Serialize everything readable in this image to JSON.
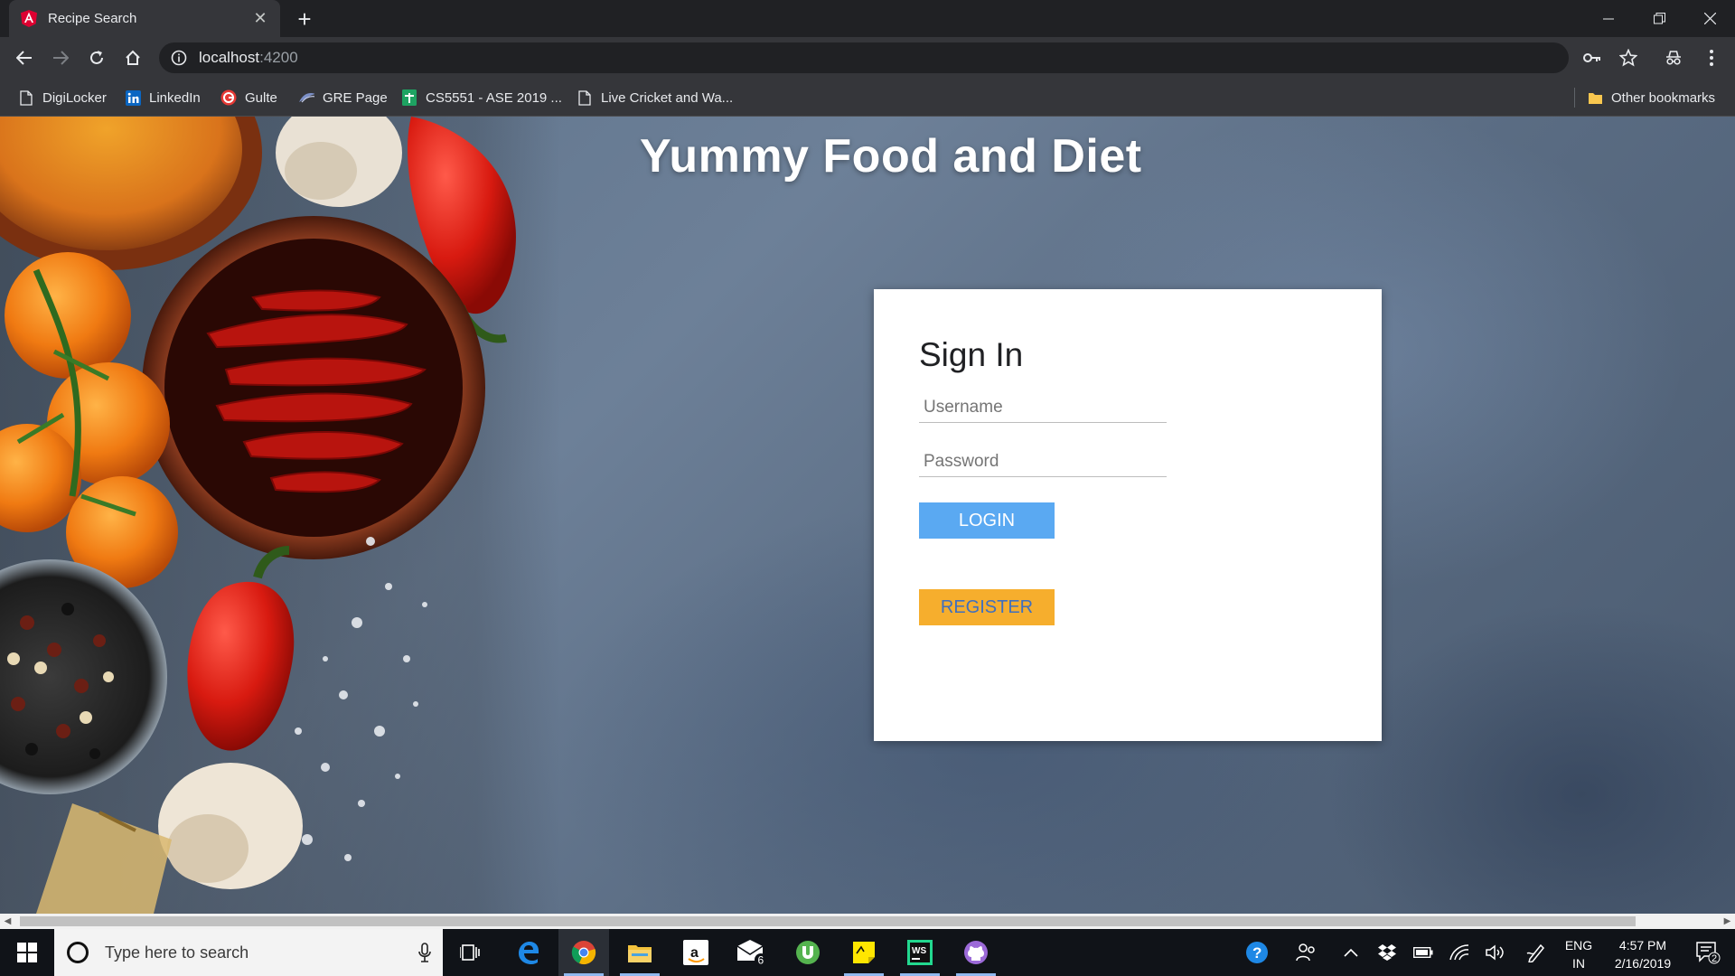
{
  "browser": {
    "tab_title": "Recipe Search",
    "url_host": "localhost",
    "url_port": ":4200",
    "bookmarks": [
      {
        "label": "DigiLocker",
        "icon": "page-icon"
      },
      {
        "label": "LinkedIn",
        "icon": "linkedin-icon"
      },
      {
        "label": "Gulte",
        "icon": "gulte-icon"
      },
      {
        "label": "GRE Page",
        "icon": "gre-icon"
      },
      {
        "label": "CS5551 - ASE 2019 ...",
        "icon": "sheets-icon"
      },
      {
        "label": "Live Cricket and Wa...",
        "icon": "page-icon"
      }
    ],
    "other_bookmarks": "Other bookmarks"
  },
  "page": {
    "title": "Yummy Food and Diet",
    "signin": {
      "heading": "Sign In",
      "username_placeholder": "Username",
      "password_placeholder": "Password",
      "login_label": "LOGIN",
      "register_label": "REGISTER"
    }
  },
  "taskbar": {
    "search_placeholder": "Type here to search",
    "mail_badge": "6",
    "language": "ENG",
    "region": "IN",
    "time": "4:57 PM",
    "date": "2/16/2019",
    "notification_count": "2"
  },
  "colors": {
    "login_bg": "#5aa9f2",
    "register_bg": "#f6ae2d",
    "register_text": "#3f6fbf",
    "chrome_dark": "#202124",
    "chrome_toolbar": "#35363a"
  }
}
